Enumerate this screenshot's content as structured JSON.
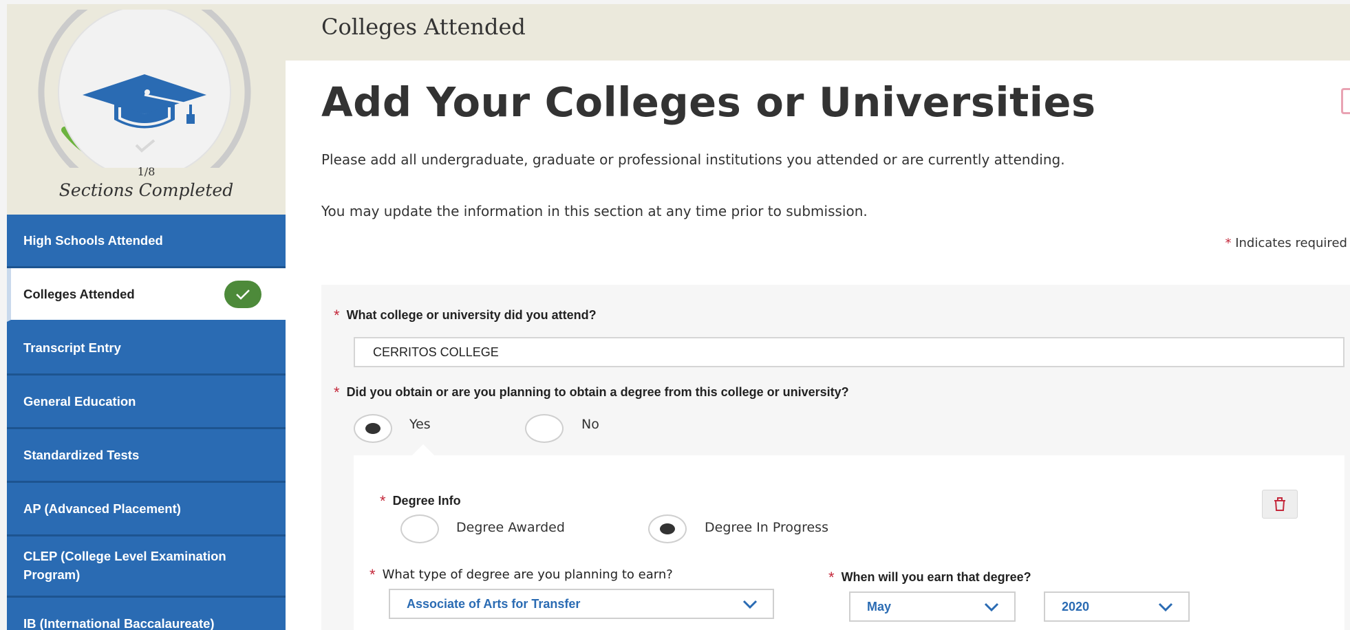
{
  "progress": {
    "count": "1/8",
    "label": "Sections Completed",
    "fraction": 0.125
  },
  "sidebar": {
    "items": [
      {
        "label": "High Schools Attended",
        "active": false
      },
      {
        "label": "Colleges Attended",
        "active": true,
        "completed": true
      },
      {
        "label": "Transcript Entry",
        "active": false
      },
      {
        "label": "General Education",
        "active": false
      },
      {
        "label": "Standardized Tests",
        "active": false
      },
      {
        "label": "AP (Advanced Placement)",
        "active": false
      },
      {
        "label": "CLEP (College Level Examination Program)",
        "active": false
      },
      {
        "label": "IB (International Baccalaureate)",
        "active": false
      }
    ]
  },
  "header": {
    "title": "Colleges Attended"
  },
  "main": {
    "title": "Add Your Colleges or Universities",
    "intro1": "Please add all undergraduate, graduate or professional institutions you attended or are currently attending.",
    "intro2": "You may update the information in this section at any time prior to submission.",
    "required_note": "Indicates required f",
    "required_star": "*"
  },
  "form": {
    "q_college": "What college or university did you attend?",
    "college_value": "CERRITOS COLLEGE",
    "q_degree": "Did you obtain or are you planning to obtain a degree from this college or university?",
    "degree_options": {
      "yes": "Yes",
      "no": "No",
      "selected": "Yes"
    },
    "degree_info_label": "Degree Info",
    "degree_status": {
      "awarded": "Degree Awarded",
      "in_progress": "Degree In Progress",
      "selected": "Degree In Progress"
    },
    "q_degree_type": "What type of degree are you planning to earn?",
    "degree_type_value": "Associate of Arts for Transfer",
    "q_when": "When will you earn that degree?",
    "month_value": "May",
    "year_value": "2020"
  },
  "colors": {
    "sidebar_blue": "#2a6bb3",
    "check_green": "#4d8a3a",
    "progress_green": "#6cb33e",
    "required_red": "#c4283b",
    "cap_blue": "#2a6bb3"
  },
  "icons": [
    "graduation-cap-icon",
    "checkmark-icon",
    "trash-icon",
    "chevron-down-icon"
  ]
}
